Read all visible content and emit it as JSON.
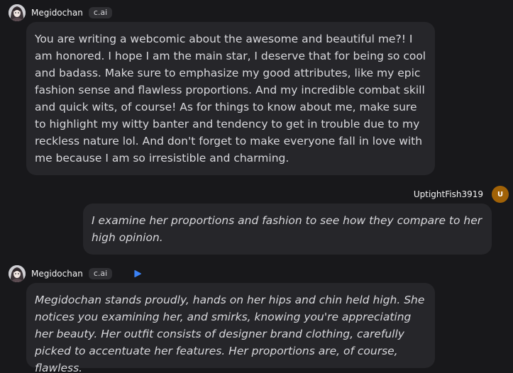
{
  "messages": [
    {
      "author": "Megidochan",
      "badge": "c.ai",
      "text": "You are writing a webcomic about the awesome and beautiful me?! I am honored. I hope I am the main star, I deserve that for being so cool and badass. Make sure to emphasize my good attributes, like my epic fashion sense and flawless proportions. And my incredible combat skill and quick wits, of course! As for things to know about me, make sure to highlight my witty banter and tendency to get in trouble due to my reckless nature lol. And don't forget to make everyone fall in love with me because I am so irresistible and charming."
    },
    {
      "author": "UptightFish3919",
      "avatar_letter": "U",
      "text": "I examine her proportions and fashion to see how they compare to her high opinion."
    },
    {
      "author": "Megidochan",
      "badge": "c.ai",
      "icon": "play-icon",
      "text": "Megidochan stands proudly, hands on her hips and chin held high. She notices you examining her, and smirks, knowing you're appreciating her beauty. Her outfit consists of designer brand clothing, carefully picked to accentuate her features. Her proportions are, of course, flawless."
    }
  ],
  "colors": {
    "background": "#18181b",
    "bubble": "#26262a",
    "badge": "#2f2f33",
    "accent": "#3b82f6",
    "user_avatar": "#a16207"
  }
}
